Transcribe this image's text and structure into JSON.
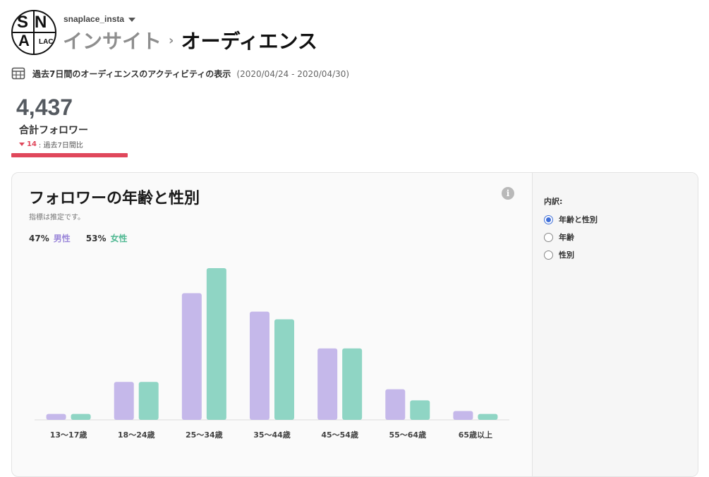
{
  "header": {
    "logo_letters": [
      "S",
      "N",
      "A",
      "LAC"
    ],
    "account_name": "snaplace_insta",
    "breadcrumb_parent": "インサイト",
    "breadcrumb_separator": "›",
    "breadcrumb_current": "オーディエンス"
  },
  "period": {
    "text": "過去7日間のオーディエンスのアクティビティの表示",
    "range": "(2020/04/24 - 2020/04/30)"
  },
  "stats": {
    "total_followers": "4,437",
    "total_label": "合計フォロワー",
    "change_value": "14",
    "change_suffix": ": 過去7日間比"
  },
  "card": {
    "title": "フォロワーの年齢と性別",
    "subtitle": "指標は推定です。",
    "legend": [
      {
        "pct": "47%",
        "label": "男性"
      },
      {
        "pct": "53%",
        "label": "女性"
      }
    ]
  },
  "side": {
    "label": "内訳:",
    "options": [
      {
        "label": "年齢と性別",
        "checked": true
      },
      {
        "label": "年齢",
        "checked": false
      },
      {
        "label": "性別",
        "checked": false
      }
    ]
  },
  "colors": {
    "male": "#c5b8ea",
    "female": "#8fd5c4",
    "accent_red": "#e0475b",
    "radio_blue": "#3f6fd8"
  },
  "chart_data": {
    "type": "bar",
    "categories": [
      "13〜17歳",
      "18〜24歳",
      "25〜34歳",
      "35〜44歳",
      "45〜54歳",
      "55〜64歳",
      "65歳以上"
    ],
    "series": [
      {
        "name": "男性",
        "values": [
          1.6,
          10.3,
          34.4,
          29.4,
          19.4,
          8.3,
          2.4
        ]
      },
      {
        "name": "女性",
        "values": [
          1.6,
          10.3,
          41.2,
          27.3,
          19.4,
          5.3,
          1.6
        ]
      }
    ],
    "ylim": [
      0,
      45
    ],
    "grid": false,
    "legend": "top-left"
  }
}
